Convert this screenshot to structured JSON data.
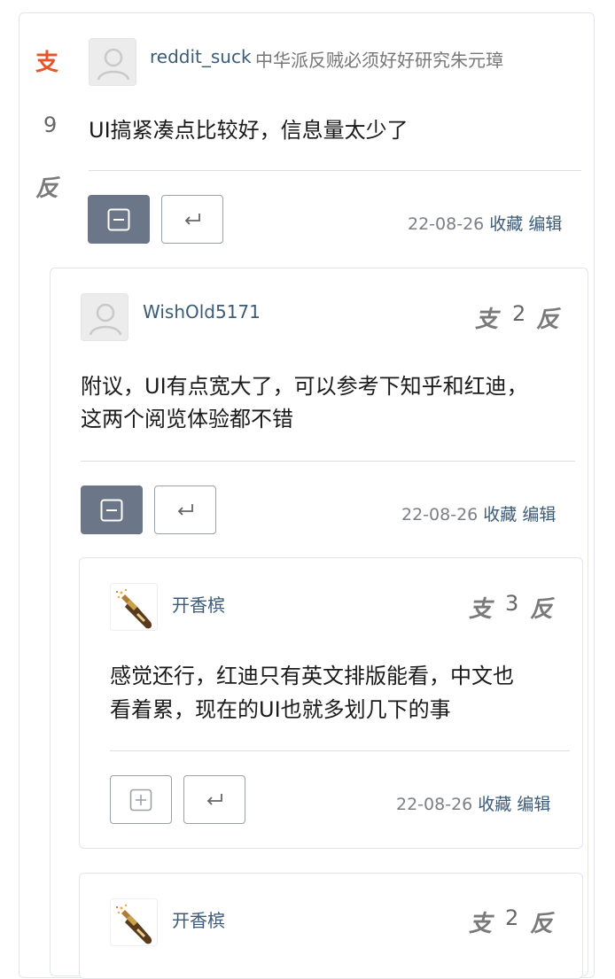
{
  "vote": {
    "support": "支",
    "oppose": "反"
  },
  "actions": {
    "favorite": "收藏",
    "edit": "编辑"
  },
  "icons": {
    "collapse": "minus-square-icon",
    "expand": "plus-square-icon",
    "reply": "reply-arrow-icon",
    "avatar_default": "user-silhouette-icon",
    "avatar_bottle": "champagne-bottle-icon"
  },
  "colors": {
    "support_active": "#e8542a",
    "vote_idle": "#7a7a7a",
    "button_dark": "#6c7689",
    "link": "#3b5b78"
  },
  "comments": [
    {
      "user": "reddit_suck",
      "flair": "中华派反贼必须好好研究朱元璋",
      "score": "9",
      "lines": [
        "UI搞紧凑点比较好，信息量太少了"
      ],
      "date": "22-08-26"
    },
    {
      "user": "WishOld5171",
      "score": "2",
      "lines": [
        "附议，UI有点宽大了，可以参考下知乎和红迪，",
        "这两个阅览体验都不错"
      ],
      "date": "22-08-26"
    },
    {
      "user": "开香槟",
      "score": "3",
      "lines": [
        "感觉还行，红迪只有英文排版能看，中文也",
        "看着累，现在的UI也就多划几下的事"
      ],
      "date": "22-08-26"
    },
    {
      "user": "开香槟",
      "score": "2"
    }
  ]
}
